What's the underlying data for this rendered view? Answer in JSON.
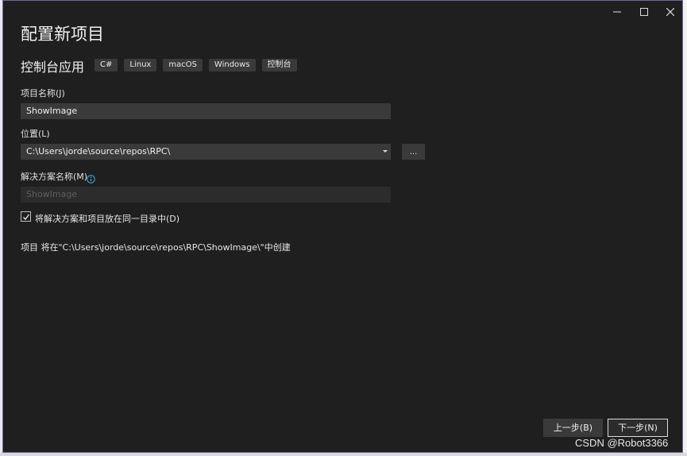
{
  "window": {
    "title": "配置新项目",
    "controls": [
      "minimize-icon",
      "maximize-icon",
      "close-icon"
    ]
  },
  "template": {
    "name": "控制台应用",
    "tags": [
      "C#",
      "Linux",
      "macOS",
      "Windows",
      "控制台"
    ]
  },
  "project_name": {
    "label": "项目名称(J)",
    "value": "ShowImage"
  },
  "location": {
    "label": "位置(L)",
    "value": "C:\\Users\\jorde\\source\\repos\\RPC\\",
    "browse_label": "..."
  },
  "solution_name": {
    "label": "解决方案名称(M)",
    "placeholder": "ShowImage",
    "info_icon": "info-icon"
  },
  "same_dir": {
    "label": "将解决方案和项目放在同一目录中(D)",
    "checked": true
  },
  "summary": "项目 将在\"C:\\Users\\jorde\\source\\repos\\RPC\\ShowImage\\\"中创建",
  "buttons": {
    "back": "上一步(B)",
    "next": "下一步(N)"
  },
  "watermark": "CSDN @Robot3366"
}
